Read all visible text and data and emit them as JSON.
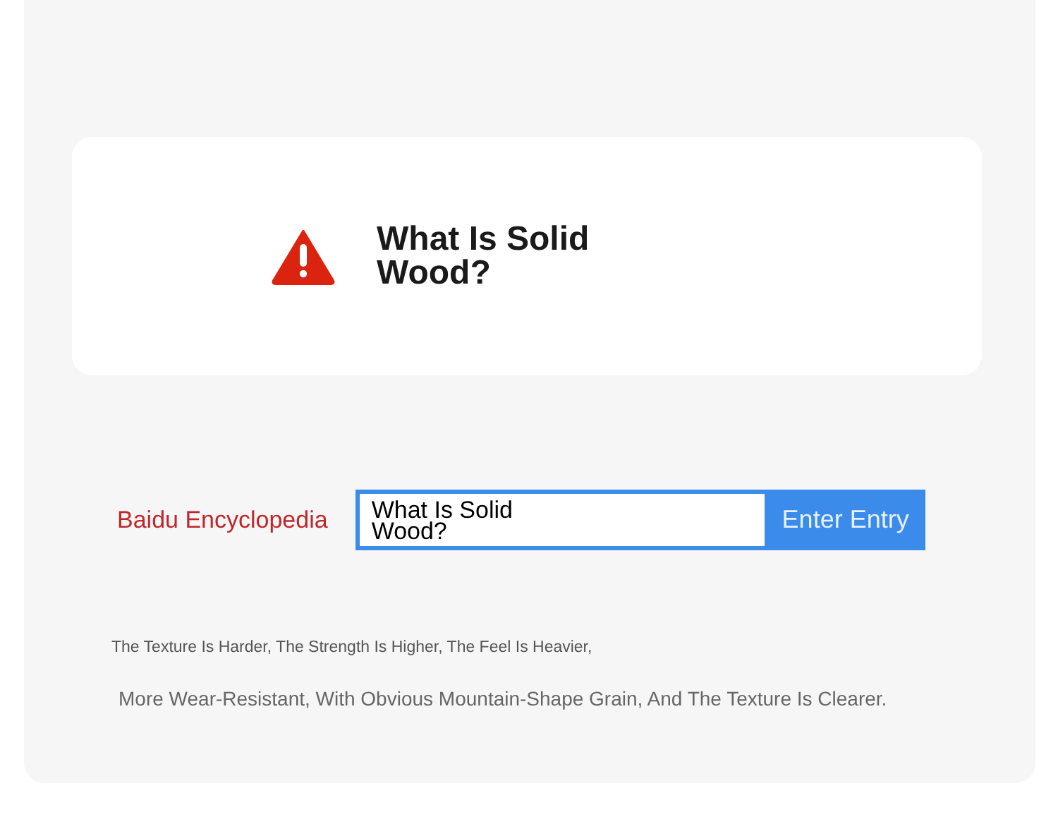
{
  "notice": {
    "title": "What Is Solid Wood?"
  },
  "search": {
    "site_label": "Baidu Encyclopedia",
    "value": "What Is Solid Wood?",
    "button": "Enter Entry"
  },
  "description": [
    "The Texture Is Harder, The Strength Is Higher, The Feel Is Heavier,",
    "More Wear-Resistant, With Obvious Mountain-Shape Grain, And The Texture Is Clearer."
  ]
}
